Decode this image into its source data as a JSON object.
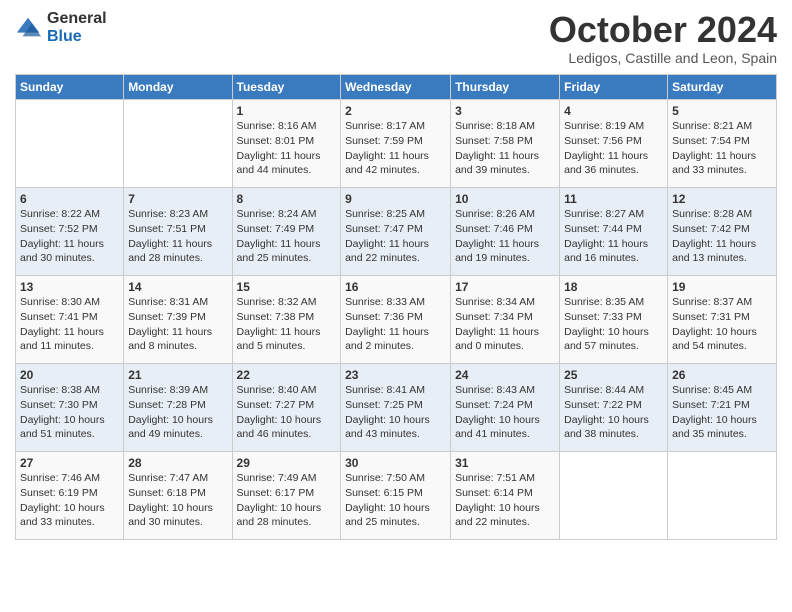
{
  "logo": {
    "line1": "General",
    "line2": "Blue"
  },
  "header": {
    "month": "October 2024",
    "location": "Ledigos, Castille and Leon, Spain"
  },
  "days_of_week": [
    "Sunday",
    "Monday",
    "Tuesday",
    "Wednesday",
    "Thursday",
    "Friday",
    "Saturday"
  ],
  "weeks": [
    [
      {
        "day": "",
        "info": ""
      },
      {
        "day": "",
        "info": ""
      },
      {
        "day": "1",
        "info": "Sunrise: 8:16 AM\nSunset: 8:01 PM\nDaylight: 11 hours and 44 minutes."
      },
      {
        "day": "2",
        "info": "Sunrise: 8:17 AM\nSunset: 7:59 PM\nDaylight: 11 hours and 42 minutes."
      },
      {
        "day": "3",
        "info": "Sunrise: 8:18 AM\nSunset: 7:58 PM\nDaylight: 11 hours and 39 minutes."
      },
      {
        "day": "4",
        "info": "Sunrise: 8:19 AM\nSunset: 7:56 PM\nDaylight: 11 hours and 36 minutes."
      },
      {
        "day": "5",
        "info": "Sunrise: 8:21 AM\nSunset: 7:54 PM\nDaylight: 11 hours and 33 minutes."
      }
    ],
    [
      {
        "day": "6",
        "info": "Sunrise: 8:22 AM\nSunset: 7:52 PM\nDaylight: 11 hours and 30 minutes."
      },
      {
        "day": "7",
        "info": "Sunrise: 8:23 AM\nSunset: 7:51 PM\nDaylight: 11 hours and 28 minutes."
      },
      {
        "day": "8",
        "info": "Sunrise: 8:24 AM\nSunset: 7:49 PM\nDaylight: 11 hours and 25 minutes."
      },
      {
        "day": "9",
        "info": "Sunrise: 8:25 AM\nSunset: 7:47 PM\nDaylight: 11 hours and 22 minutes."
      },
      {
        "day": "10",
        "info": "Sunrise: 8:26 AM\nSunset: 7:46 PM\nDaylight: 11 hours and 19 minutes."
      },
      {
        "day": "11",
        "info": "Sunrise: 8:27 AM\nSunset: 7:44 PM\nDaylight: 11 hours and 16 minutes."
      },
      {
        "day": "12",
        "info": "Sunrise: 8:28 AM\nSunset: 7:42 PM\nDaylight: 11 hours and 13 minutes."
      }
    ],
    [
      {
        "day": "13",
        "info": "Sunrise: 8:30 AM\nSunset: 7:41 PM\nDaylight: 11 hours and 11 minutes."
      },
      {
        "day": "14",
        "info": "Sunrise: 8:31 AM\nSunset: 7:39 PM\nDaylight: 11 hours and 8 minutes."
      },
      {
        "day": "15",
        "info": "Sunrise: 8:32 AM\nSunset: 7:38 PM\nDaylight: 11 hours and 5 minutes."
      },
      {
        "day": "16",
        "info": "Sunrise: 8:33 AM\nSunset: 7:36 PM\nDaylight: 11 hours and 2 minutes."
      },
      {
        "day": "17",
        "info": "Sunrise: 8:34 AM\nSunset: 7:34 PM\nDaylight: 11 hours and 0 minutes."
      },
      {
        "day": "18",
        "info": "Sunrise: 8:35 AM\nSunset: 7:33 PM\nDaylight: 10 hours and 57 minutes."
      },
      {
        "day": "19",
        "info": "Sunrise: 8:37 AM\nSunset: 7:31 PM\nDaylight: 10 hours and 54 minutes."
      }
    ],
    [
      {
        "day": "20",
        "info": "Sunrise: 8:38 AM\nSunset: 7:30 PM\nDaylight: 10 hours and 51 minutes."
      },
      {
        "day": "21",
        "info": "Sunrise: 8:39 AM\nSunset: 7:28 PM\nDaylight: 10 hours and 49 minutes."
      },
      {
        "day": "22",
        "info": "Sunrise: 8:40 AM\nSunset: 7:27 PM\nDaylight: 10 hours and 46 minutes."
      },
      {
        "day": "23",
        "info": "Sunrise: 8:41 AM\nSunset: 7:25 PM\nDaylight: 10 hours and 43 minutes."
      },
      {
        "day": "24",
        "info": "Sunrise: 8:43 AM\nSunset: 7:24 PM\nDaylight: 10 hours and 41 minutes."
      },
      {
        "day": "25",
        "info": "Sunrise: 8:44 AM\nSunset: 7:22 PM\nDaylight: 10 hours and 38 minutes."
      },
      {
        "day": "26",
        "info": "Sunrise: 8:45 AM\nSunset: 7:21 PM\nDaylight: 10 hours and 35 minutes."
      }
    ],
    [
      {
        "day": "27",
        "info": "Sunrise: 7:46 AM\nSunset: 6:19 PM\nDaylight: 10 hours and 33 minutes."
      },
      {
        "day": "28",
        "info": "Sunrise: 7:47 AM\nSunset: 6:18 PM\nDaylight: 10 hours and 30 minutes."
      },
      {
        "day": "29",
        "info": "Sunrise: 7:49 AM\nSunset: 6:17 PM\nDaylight: 10 hours and 28 minutes."
      },
      {
        "day": "30",
        "info": "Sunrise: 7:50 AM\nSunset: 6:15 PM\nDaylight: 10 hours and 25 minutes."
      },
      {
        "day": "31",
        "info": "Sunrise: 7:51 AM\nSunset: 6:14 PM\nDaylight: 10 hours and 22 minutes."
      },
      {
        "day": "",
        "info": ""
      },
      {
        "day": "",
        "info": ""
      }
    ]
  ]
}
